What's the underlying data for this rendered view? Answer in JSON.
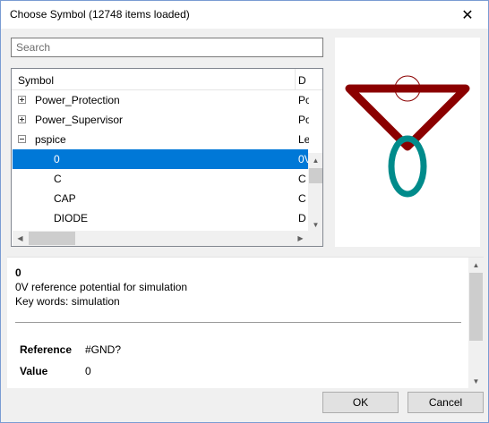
{
  "window": {
    "title": "Choose Symbol (12748 items loaded)",
    "close_glyph": "✕"
  },
  "search": {
    "placeholder": "Search",
    "value": ""
  },
  "tree": {
    "columns": [
      "Symbol",
      "D"
    ],
    "rows": [
      {
        "label": "Power_Protection",
        "desc": "Po",
        "expander": "plus"
      },
      {
        "label": "Power_Supervisor",
        "desc": "Po",
        "expander": "plus"
      },
      {
        "label": "pspice",
        "desc": "Le",
        "expander": "minus"
      },
      {
        "label": "0",
        "desc": "0V",
        "selected": true
      },
      {
        "label": "C",
        "desc": "C"
      },
      {
        "label": "CAP",
        "desc": "C"
      },
      {
        "label": "DIODE",
        "desc": "D"
      }
    ]
  },
  "scroll_glyphs": {
    "up": "▲",
    "down": "▼",
    "left": "◀",
    "right": "▶"
  },
  "preview": {
    "icon": "ground-symbol-preview",
    "colors": {
      "body": "#8b0000",
      "pin": "#008b8b"
    }
  },
  "details": {
    "name": "0",
    "description": "0V reference potential for simulation",
    "keywords": "Key words: simulation",
    "fields": [
      {
        "label": "Reference",
        "value": "#GND?"
      },
      {
        "label": "Value",
        "value": "0"
      }
    ]
  },
  "buttons": {
    "ok": "OK",
    "cancel": "Cancel"
  },
  "colors": {
    "selection": "#0078d7"
  }
}
